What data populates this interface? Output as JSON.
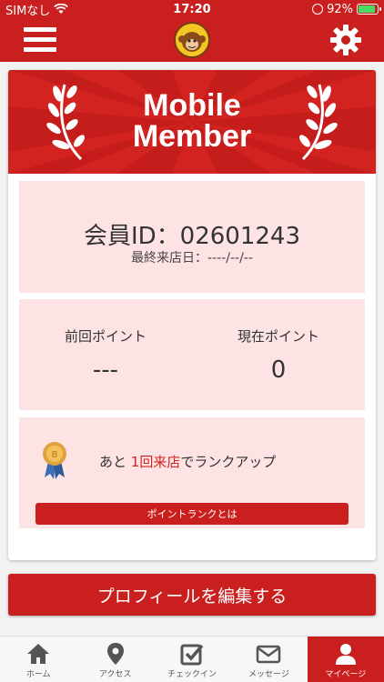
{
  "status": {
    "carrier": "SIMなし",
    "time": "17:20",
    "battery": "92%"
  },
  "header": {
    "menu_icon": "hamburger-icon",
    "settings_icon": "gear-icon",
    "logo": "monkey-logo"
  },
  "banner": {
    "line1": "Mobile",
    "line2": "Member"
  },
  "member": {
    "id_label": "会員ID：02601243",
    "last_visit": "最終来店日：----/--/--"
  },
  "points": {
    "previous_label": "前回ポイント",
    "previous_value": "---",
    "current_label": "現在ポイント",
    "current_value": "0"
  },
  "rank": {
    "prefix": "あと ",
    "highlight": "1回来店",
    "suffix": "でランクアップ",
    "button": "ポイントランクとは"
  },
  "edit_profile": "プロフィールを編集する",
  "tabs": [
    {
      "label": "ホーム",
      "icon": "home-icon"
    },
    {
      "label": "アクセス",
      "icon": "map-pin-icon"
    },
    {
      "label": "チェックイン",
      "icon": "checkbox-icon"
    },
    {
      "label": "メッセージ",
      "icon": "envelope-icon"
    },
    {
      "label": "マイページ",
      "icon": "user-icon",
      "active": true
    }
  ],
  "colors": {
    "brand_red": "#c9201f",
    "panel_pink": "#fde3e3",
    "highlight_red": "#d32321"
  }
}
